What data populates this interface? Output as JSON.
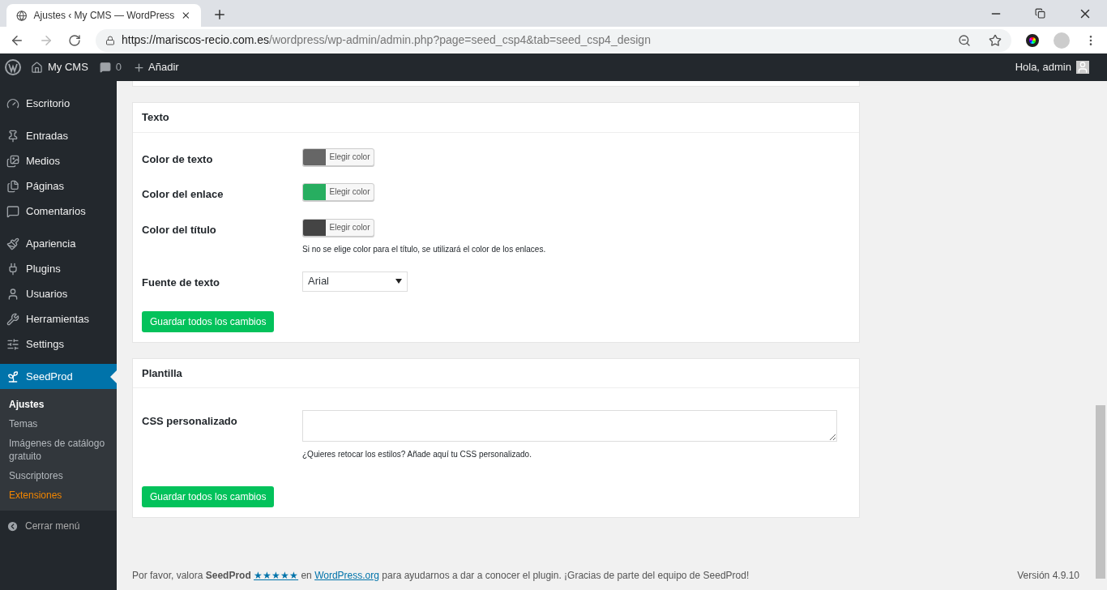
{
  "browser": {
    "tab_title": "Ajustes ‹ My CMS — WordPress",
    "url_host": "https://mariscos-recio.com.es",
    "url_path": "/wordpress/wp-admin/admin.php?page=seed_csp4&tab=seed_csp4_design"
  },
  "admin_bar": {
    "site": "My CMS",
    "comments": "0",
    "new": "Añadir",
    "greeting": "Hola, admin"
  },
  "sidebar": {
    "groups": [
      [
        {
          "label": "Escritorio",
          "selected": false
        }
      ],
      [
        {
          "label": "Entradas",
          "selected": false
        },
        {
          "label": "Medios",
          "selected": false
        },
        {
          "label": "Páginas",
          "selected": false
        },
        {
          "label": "Comentarios",
          "selected": false
        }
      ],
      [
        {
          "label": "Apariencia",
          "selected": false
        },
        {
          "label": "Plugins",
          "selected": false
        },
        {
          "label": "Usuarios",
          "selected": false
        },
        {
          "label": "Herramientas",
          "selected": false
        },
        {
          "label": "Settings",
          "selected": false
        }
      ],
      [
        {
          "label": "SeedProd",
          "selected": true
        }
      ]
    ],
    "submenu": [
      {
        "label": "Ajustes",
        "selected": true,
        "kind": "link"
      },
      {
        "label": "Temas",
        "selected": false,
        "kind": "link"
      },
      {
        "label": "Imágenes de catálogo gratuito",
        "selected": false,
        "kind": "link"
      },
      {
        "label": "Suscriptores",
        "selected": false,
        "kind": "link"
      },
      {
        "label": "Extensiones",
        "selected": false,
        "kind": "upsell"
      }
    ],
    "collapse": "Cerrar menú"
  },
  "sections": [
    {
      "title": "Texto",
      "rows": [
        {
          "kind": "color",
          "label": "Color de texto",
          "button": "Elegir color",
          "color": "#666666"
        },
        {
          "kind": "color",
          "label": "Color del enlace",
          "button": "Elegir color",
          "color": "#27ae60"
        },
        {
          "kind": "color",
          "label": "Color del título",
          "button": "Elegir color",
          "color": "#444444",
          "help": "Si no se elige color para el título, se utilizará el color de los enlaces."
        },
        {
          "kind": "select",
          "label": "Fuente de texto",
          "value": "Arial"
        }
      ],
      "save": "Guardar todos los cambios"
    },
    {
      "title": "Plantilla",
      "rows": [
        {
          "kind": "textarea",
          "label": "CSS personalizado",
          "help": "¿Quieres retocar los estilos? Añade aquí tu CSS personalizado."
        }
      ],
      "save": "Guardar todos los cambios"
    }
  ],
  "footer": {
    "before": "Por favor, valora **SeedProd**",
    "stars_link": "★★★★★",
    "middle": "en",
    "site_link": "WordPress.org",
    "after": "para ayudarnos a dar a conocer el plugin. ¡Gracias de parte del equipo de SeedProd!",
    "version": "Versión 4.9.10"
  }
}
